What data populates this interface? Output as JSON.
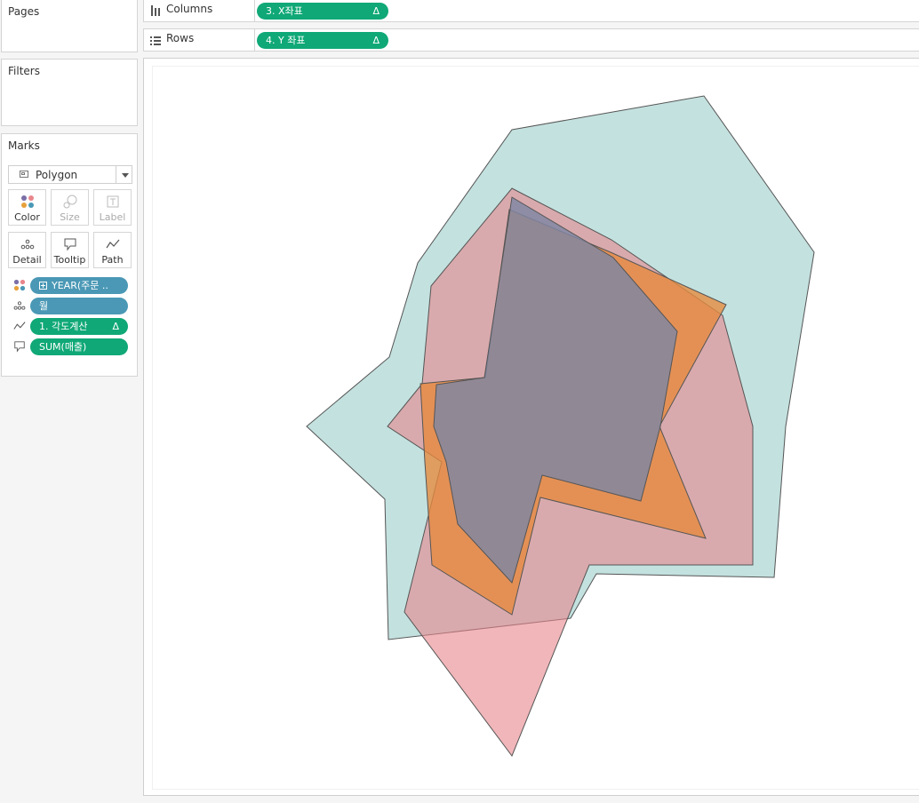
{
  "pages_card": {
    "title": "Pages"
  },
  "filters_card": {
    "title": "Filters"
  },
  "marks_card": {
    "title": "Marks",
    "mark_type": "Polygon",
    "buttons": [
      {
        "label": "Color",
        "icon": "color-dots-icon",
        "enabled": true
      },
      {
        "label": "Size",
        "icon": "size-icon",
        "enabled": false
      },
      {
        "label": "Label",
        "icon": "label-icon",
        "enabled": false
      },
      {
        "label": "Detail",
        "icon": "detail-dots-icon",
        "enabled": true
      },
      {
        "label": "Tooltip",
        "icon": "tooltip-icon",
        "enabled": true
      },
      {
        "label": "Path",
        "icon": "path-icon",
        "enabled": true
      }
    ],
    "fields": [
      {
        "text": "YEAR(주문 ..",
        "shelf_icon": "color-dots-icon",
        "color": "#4a98b5",
        "has_plus": true
      },
      {
        "text": "월",
        "shelf_icon": "detail-dots-icon",
        "color": "#4a98b5"
      },
      {
        "text": "1. 각도계산",
        "shelf_icon": "path-icon",
        "color": "#0fa876",
        "delta": "Δ"
      },
      {
        "text": "SUM(매출)",
        "shelf_icon": "tooltip-icon",
        "color": "#0fa876"
      }
    ]
  },
  "shelves": {
    "columns": {
      "label": "Columns",
      "pill": "3. X좌표",
      "delta": "Δ"
    },
    "rows": {
      "label": "Rows",
      "pill": "4. Y 좌표",
      "delta": "Δ"
    }
  },
  "colors": {
    "discrete_dimension": "#4a98b5",
    "continuous_measure": "#0fa876"
  },
  "chart_data": {
    "type": "polygon",
    "title": "",
    "xlabel": "",
    "ylabel": "",
    "axes_visible": false,
    "grid": false,
    "series": [
      {
        "color": "#91c9c5",
        "opacity": 0.55,
        "points": [
          [
            576,
            146
          ],
          [
            792,
            108
          ],
          [
            916,
            284
          ],
          [
            884,
            480
          ],
          [
            871,
            650
          ],
          [
            671,
            646
          ],
          [
            642,
            696
          ],
          [
            437,
            720
          ],
          [
            433,
            562
          ],
          [
            345,
            480
          ],
          [
            438,
            402
          ],
          [
            470,
            296
          ]
        ]
      },
      {
        "color": "#e8868c",
        "opacity": 0.6,
        "points": [
          [
            576,
            212
          ],
          [
            688,
            270
          ],
          [
            813,
            355
          ],
          [
            847,
            480
          ],
          [
            847,
            636
          ],
          [
            663,
            636
          ],
          [
            576,
            851
          ],
          [
            455,
            689
          ],
          [
            497,
            520
          ],
          [
            436,
            480
          ],
          [
            475,
            432
          ],
          [
            485,
            322
          ]
        ]
      },
      {
        "color": "#e7893c",
        "opacity": 0.78,
        "points": [
          [
            573,
            236
          ],
          [
            687,
            284
          ],
          [
            817,
            343
          ],
          [
            742,
            480
          ],
          [
            794,
            606
          ],
          [
            608,
            560
          ],
          [
            576,
            692
          ],
          [
            486,
            636
          ],
          [
            478,
            520
          ],
          [
            473,
            432
          ],
          [
            546,
            425
          ]
        ]
      },
      {
        "color": "#7f86a4",
        "opacity": 0.82,
        "points": [
          [
            576,
            222
          ],
          [
            690,
            290
          ],
          [
            762,
            373
          ],
          [
            743,
            480
          ],
          [
            721,
            564
          ],
          [
            610,
            535
          ],
          [
            576,
            656
          ],
          [
            515,
            590
          ],
          [
            502,
            520
          ],
          [
            488,
            480
          ],
          [
            491,
            433
          ],
          [
            545,
            425
          ]
        ]
      }
    ]
  }
}
